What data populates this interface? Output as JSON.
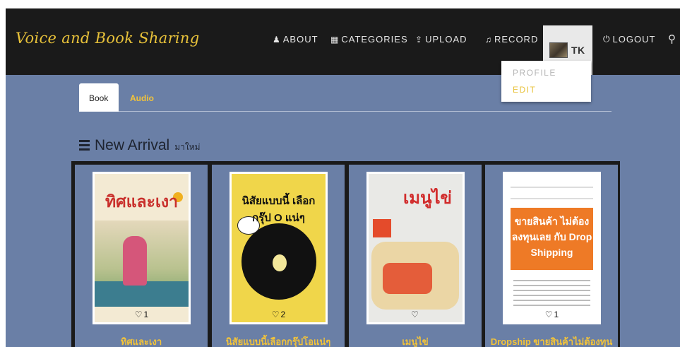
{
  "brand": {
    "name": "Voice and Book Sharing"
  },
  "nav": {
    "about": "ABOUT",
    "categories": "CATEGORIES",
    "upload": "UPLOAD",
    "record": "RECORD",
    "user": "TK",
    "logout": "LOGOUT"
  },
  "user_menu": {
    "profile": "PROFILE",
    "edit": "EDIT"
  },
  "tabs": [
    {
      "label": "Book",
      "active": true
    },
    {
      "label": "Audio",
      "active": false
    }
  ],
  "section": {
    "title": "New Arrival",
    "subtitle": "มาใหม่"
  },
  "books": [
    {
      "title": "ทิศและเงา",
      "cover_text": "ทิศและเงา",
      "likes": "1"
    },
    {
      "title": "นิสัยแบบนี้เลือกกรุ๊ปโอแน่ๆ",
      "cover_text": "นิสัยแบบนี้ เลือกกรุ๊ป O แน่ๆ",
      "likes": "2"
    },
    {
      "title": "เมนูไข่",
      "cover_text": "เมนูไข่",
      "likes": ""
    },
    {
      "title": "Dropship ขายสินค้าไม่ต้องทุน",
      "cover_text": "ขายสินค้า ไม่ต้องลงทุนเลย กับ Drop Shipping",
      "likes": "1"
    }
  ],
  "icons": {
    "about": "person-icon",
    "categories": "grid-icon",
    "upload": "upload-icon",
    "record": "music-note-icon",
    "logout": "power-icon",
    "search": "search-icon",
    "section": "list-icon",
    "likes": "heart-icon"
  },
  "colors": {
    "accent": "#e8c23a",
    "navbar": "#1a1a1a",
    "page": "#6a7fa6"
  }
}
